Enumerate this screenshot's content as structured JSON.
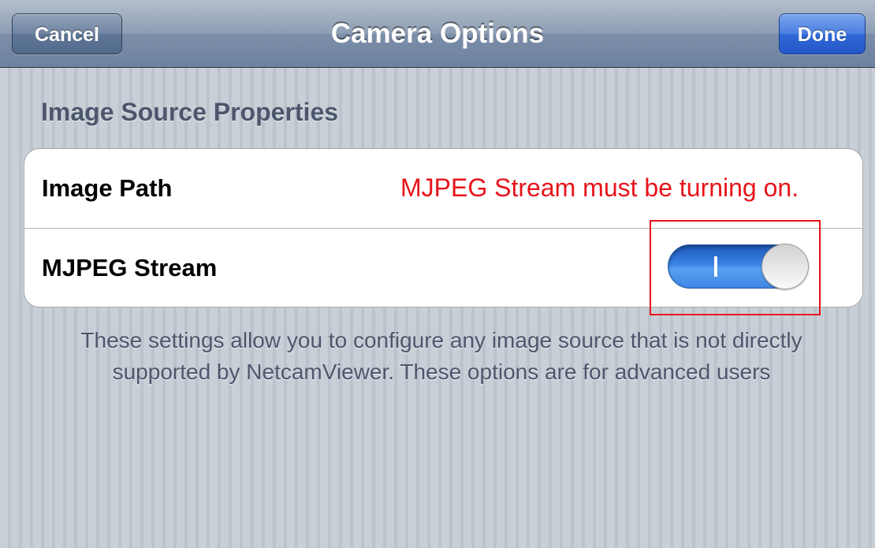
{
  "navbar": {
    "title": "Camera Options",
    "cancel_label": "Cancel",
    "done_label": "Done"
  },
  "section": {
    "header": "Image Source Properties",
    "rows": [
      {
        "label": "Image Path"
      },
      {
        "label": "MJPEG Stream",
        "toggle_state": "on",
        "toggle_on_glyph": "I"
      }
    ],
    "footer": "These settings allow you to configure any image source that is not directly supported by NetcamViewer. These options are for advanced users"
  },
  "annotation": {
    "text": "MJPEG Stream must be turning on.",
    "color": "#e8141b"
  },
  "colors": {
    "toggle_on": "#3a83e6",
    "done_button": "#2f68d6",
    "navbar": "#7c8ea8"
  }
}
